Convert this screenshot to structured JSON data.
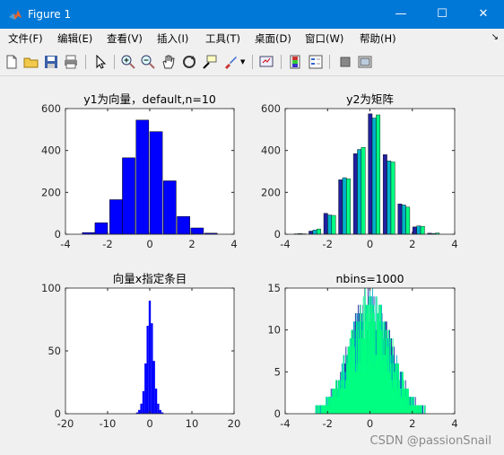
{
  "window": {
    "title": "Figure 1",
    "titlebar_color": "#0078d7",
    "controls": {
      "minimize": "—",
      "maximize": "☐",
      "close": "✕"
    }
  },
  "menubar": {
    "items": [
      "文件(F)",
      "编辑(E)",
      "查看(V)",
      "插入(I)",
      "工具(T)",
      "桌面(D)",
      "窗口(W)",
      "帮助(H)"
    ],
    "overflow_icon": "dock-arrow-icon"
  },
  "toolbar": {
    "buttons": [
      "new-figure-icon",
      "open-file-icon",
      "save-icon",
      "print-icon",
      "pointer-icon",
      "zoom-in-icon",
      "zoom-out-icon",
      "pan-hand-icon",
      "rotate-3d-icon",
      "data-cursor-icon",
      "brush-icon",
      "brush-dropdown-icon",
      "link-plot-icon",
      "colorbar-icon",
      "legend-icon",
      "hide-plot-tools-icon",
      "show-plot-tools-icon"
    ]
  },
  "watermark": "CSDN @passionSnail",
  "colors": {
    "blue": "#0000ff",
    "dark_blue": "#2020a0",
    "cyan": "#00b0c8",
    "green": "#00ff80"
  },
  "chart_data": [
    {
      "type": "bar",
      "title": "y1为向量，default,n=10",
      "xlim": [
        -4,
        4
      ],
      "ylim": [
        0,
        600
      ],
      "xticks": [
        -4,
        -2,
        0,
        2,
        4
      ],
      "yticks": [
        0,
        200,
        400,
        600
      ],
      "x": [
        -2.9,
        -2.3,
        -1.6,
        -1.0,
        -0.35,
        0.3,
        0.95,
        1.6,
        2.25,
        2.9
      ],
      "values": [
        8,
        55,
        165,
        365,
        545,
        490,
        255,
        85,
        30,
        5
      ],
      "color": "#0000ff"
    },
    {
      "type": "bar",
      "title": "y2为矩阵",
      "xlim": [
        -4,
        4
      ],
      "ylim": [
        0,
        600
      ],
      "xticks": [
        -4,
        -2,
        0,
        2,
        4
      ],
      "yticks": [
        0,
        200,
        400,
        600
      ],
      "categories": [
        -3.3,
        -2.6,
        -1.9,
        -1.2,
        -0.5,
        0.2,
        0.9,
        1.6,
        2.3,
        3.0
      ],
      "series": [
        {
          "color": "#2020a0",
          "values": [
            2,
            15,
            100,
            260,
            385,
            575,
            380,
            145,
            35,
            5
          ]
        },
        {
          "color": "#00b0c8",
          "values": [
            3,
            20,
            92,
            270,
            405,
            555,
            350,
            140,
            40,
            4
          ]
        },
        {
          "color": "#00ff80",
          "values": [
            2,
            25,
            90,
            265,
            415,
            570,
            345,
            130,
            38,
            6
          ]
        }
      ]
    },
    {
      "type": "bar",
      "title": "向量x指定条目",
      "xlim": [
        -20,
        20
      ],
      "ylim": [
        0,
        100
      ],
      "xticks": [
        -20,
        -10,
        0,
        10,
        20
      ],
      "yticks": [
        0,
        50,
        100
      ],
      "x": [
        -3.0,
        -2.5,
        -2.0,
        -1.5,
        -1.0,
        -0.5,
        0.0,
        0.5,
        1.0,
        1.5,
        2.0,
        2.5,
        3.0
      ],
      "values": [
        1,
        3,
        8,
        18,
        40,
        70,
        90,
        72,
        42,
        20,
        8,
        3,
        1
      ],
      "color": "#0000ff"
    },
    {
      "type": "bar",
      "title": "nbins=1000",
      "xlim": [
        -4,
        4
      ],
      "ylim": [
        0,
        15
      ],
      "xticks": [
        -4,
        -2,
        0,
        2,
        4
      ],
      "yticks": [
        0,
        5,
        10,
        15
      ],
      "x_range": [
        -3.6,
        3.6
      ],
      "peak": 14,
      "series": [
        {
          "color": "#2020a0"
        },
        {
          "color": "#00b0c8"
        },
        {
          "color": "#00ff80"
        }
      ]
    }
  ]
}
